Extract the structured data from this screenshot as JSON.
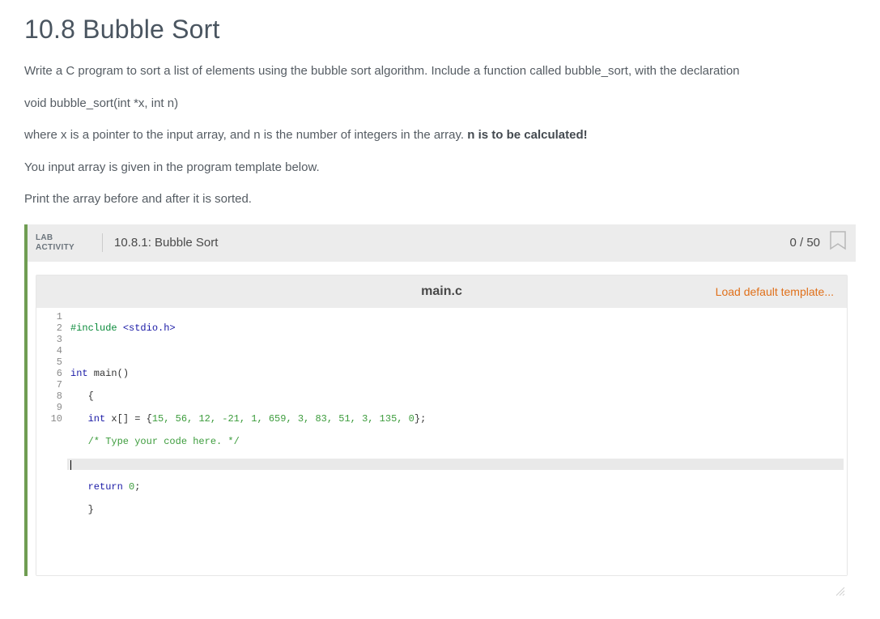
{
  "title": "10.8 Bubble Sort",
  "description": {
    "p1": "Write a C program to sort a list of elements using the bubble sort algorithm. Include a function called bubble_sort, with the declaration",
    "p2": "void bubble_sort(int *x, int n)",
    "p3a": "where x is a pointer to the input array, and n is the number of integers in the array. ",
    "p3b": "n is to be calculated!",
    "p4": "You input array is given in the program template below.",
    "p5": "Print the array before and after it is sorted."
  },
  "lab": {
    "activity_line1": "LAB",
    "activity_line2": "ACTIVITY",
    "title": "10.8.1: Bubble Sort",
    "score": "0 / 50"
  },
  "editor": {
    "filename": "main.c",
    "load_default": "Load default template...",
    "line_count": 10,
    "active_line": 7,
    "code": {
      "l1_pre": "#include ",
      "l1_inc": "<stdio.h>",
      "l2": "",
      "l3_kw": "int",
      "l3_rest": " main()",
      "l4": "   {",
      "l5_a": "   ",
      "l5_kw": "int",
      "l5_b": " x[] = {",
      "l5_nums": "15, 56, 12, -21, 1, 659, 3, 83, 51, 3, 135, 0",
      "l5_c": "};",
      "l6": "   /* Type your code here. */",
      "l7": "",
      "l8_a": "   ",
      "l8_kw": "return",
      "l8_b": " ",
      "l8_num": "0",
      "l8_c": ";",
      "l9": "   }",
      "l10": ""
    }
  }
}
